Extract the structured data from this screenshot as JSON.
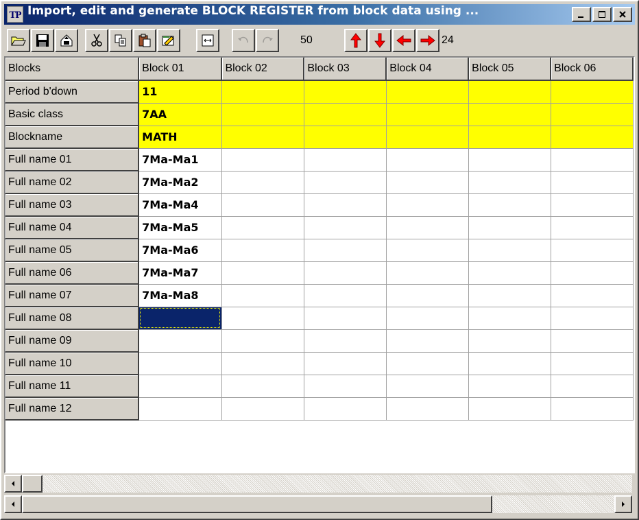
{
  "window": {
    "title": "Import, edit and generate BLOCK REGISTER from block data using ...",
    "icon_text": "TP"
  },
  "titlebar_buttons": [
    {
      "name": "minimize-button",
      "glyph": "_"
    },
    {
      "name": "maximize-button",
      "glyph": "□"
    },
    {
      "name": "close-button",
      "glyph": "✕"
    }
  ],
  "toolbar": {
    "zoom_value": "50",
    "count_value": "24",
    "buttons": [
      "open-icon",
      "save-icon",
      "export-icon",
      "cut-icon",
      "copy-icon",
      "paste-icon",
      "edit-icon",
      "fit-width-icon",
      "undo-icon",
      "redo-icon",
      "move-up-icon",
      "move-down-icon",
      "move-left-icon",
      "move-right-icon"
    ]
  },
  "grid": {
    "corner_label": "Blocks",
    "columns": [
      "Block 01",
      "Block 02",
      "Block 03",
      "Block 04",
      "Block 05",
      "Block 06"
    ],
    "rows": [
      {
        "label": "Period b'down",
        "values": [
          "11",
          "",
          "",
          "",
          "",
          ""
        ],
        "highlight": true
      },
      {
        "label": "Basic class",
        "values": [
          "7AA",
          "",
          "",
          "",
          "",
          ""
        ],
        "highlight": true
      },
      {
        "label": "Blockname",
        "values": [
          "MATH",
          "",
          "",
          "",
          "",
          ""
        ],
        "highlight": true
      },
      {
        "label": "Full name 01",
        "values": [
          "7Ma-Ma1",
          "",
          "",
          "",
          "",
          ""
        ]
      },
      {
        "label": "Full name 02",
        "values": [
          "7Ma-Ma2",
          "",
          "",
          "",
          "",
          ""
        ]
      },
      {
        "label": "Full name 03",
        "values": [
          "7Ma-Ma4",
          "",
          "",
          "",
          "",
          ""
        ]
      },
      {
        "label": "Full name 04",
        "values": [
          "7Ma-Ma5",
          "",
          "",
          "",
          "",
          ""
        ]
      },
      {
        "label": "Full name 05",
        "values": [
          "7Ma-Ma6",
          "",
          "",
          "",
          "",
          ""
        ]
      },
      {
        "label": "Full name 06",
        "values": [
          "7Ma-Ma7",
          "",
          "",
          "",
          "",
          ""
        ]
      },
      {
        "label": "Full name 07",
        "values": [
          "7Ma-Ma8",
          "",
          "",
          "",
          "",
          ""
        ]
      },
      {
        "label": "Full name 08",
        "values": [
          "",
          "",
          "",
          "",
          "",
          ""
        ],
        "selected_col": 0
      },
      {
        "label": "Full name 09",
        "values": [
          "",
          "",
          "",
          "",
          "",
          ""
        ]
      },
      {
        "label": "Full name 10",
        "values": [
          "",
          "",
          "",
          "",
          "",
          ""
        ]
      },
      {
        "label": "Full name 11",
        "values": [
          "",
          "",
          "",
          "",
          "",
          ""
        ]
      },
      {
        "label": "Full name 12",
        "values": [
          "",
          "",
          "",
          "",
          "",
          ""
        ]
      }
    ]
  },
  "colors": {
    "highlight": "#ffff00",
    "selection": "#0a246a",
    "title_start": "#0a246a"
  }
}
